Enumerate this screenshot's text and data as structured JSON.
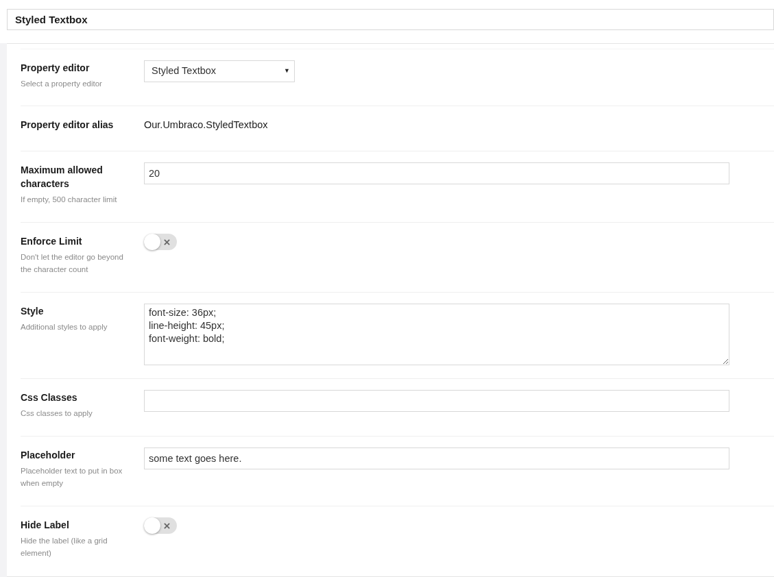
{
  "name_field": {
    "value": "Styled Textbox"
  },
  "properties": [
    {
      "kind": "select",
      "label": "Property editor",
      "description": "Select a property editor",
      "value": "Styled Textbox",
      "caret": "▼"
    },
    {
      "kind": "text",
      "label": "Property editor alias",
      "value": "Our.Umbraco.StyledTextbox"
    },
    {
      "kind": "input",
      "label": "Maximum allowed characters",
      "description": "If empty, 500 character limit",
      "value": "20"
    },
    {
      "kind": "toggle",
      "label": "Enforce Limit",
      "description": "Don't let the editor go beyond the character count",
      "on": false
    },
    {
      "kind": "textarea",
      "label": "Style",
      "description": "Additional styles to apply",
      "value": "font-size: 36px;\nline-height: 45px;\nfont-weight: bold;"
    },
    {
      "kind": "input",
      "label": "Css Classes",
      "description": "Css classes to apply"
    },
    {
      "kind": "input",
      "label": "Placeholder",
      "description": "Placeholder text to put in box when empty",
      "value": "some text goes here."
    },
    {
      "kind": "toggle",
      "label": "Hide Label",
      "description": "Hide the label (like a grid element)",
      "on": false
    }
  ]
}
